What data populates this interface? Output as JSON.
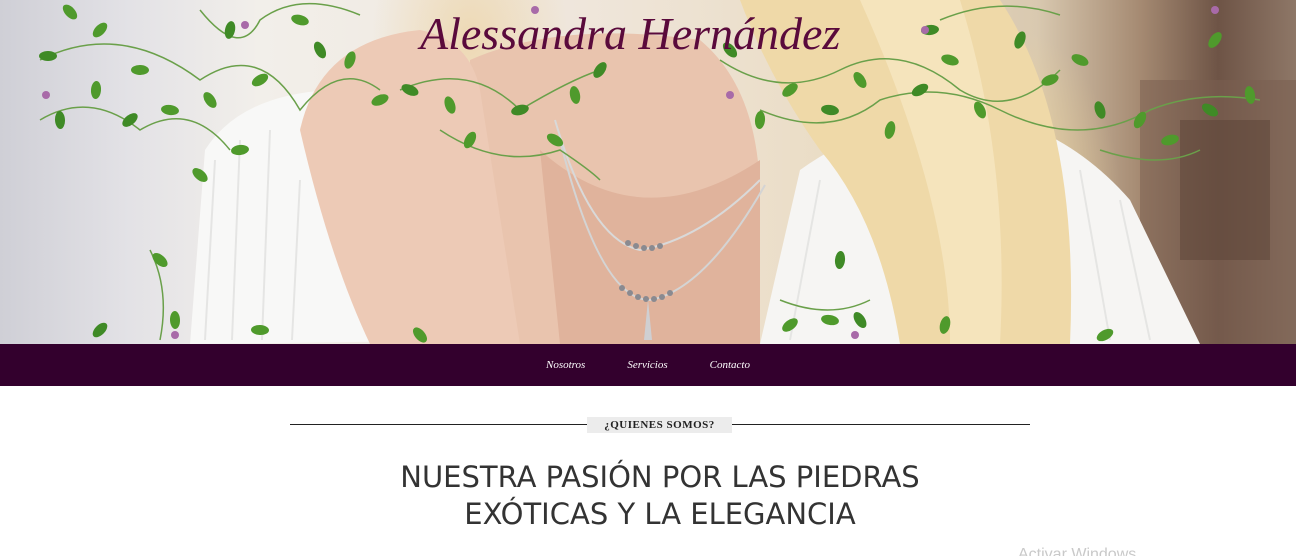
{
  "header": {
    "title": "Alessandra Hernández",
    "background": "photo-woman-necklace-with-vines"
  },
  "nav": {
    "items": [
      "Nosotros",
      "Servicios",
      "Contacto"
    ],
    "background_color": "#33002d"
  },
  "section": {
    "badge": "¿QUIENES SOMOS?",
    "headline_line1": "NUESTRA PASIÓN POR LAS PIEDRAS",
    "headline_line2": "EXÓTICAS Y LA ELEGANCIA"
  },
  "watermark": {
    "text": "Activar Windows"
  },
  "colors": {
    "title": "#5a0a3c",
    "nav_bg": "#33002d",
    "vine_leaf": "#4f9a2c",
    "flower": "#a86aa8"
  }
}
